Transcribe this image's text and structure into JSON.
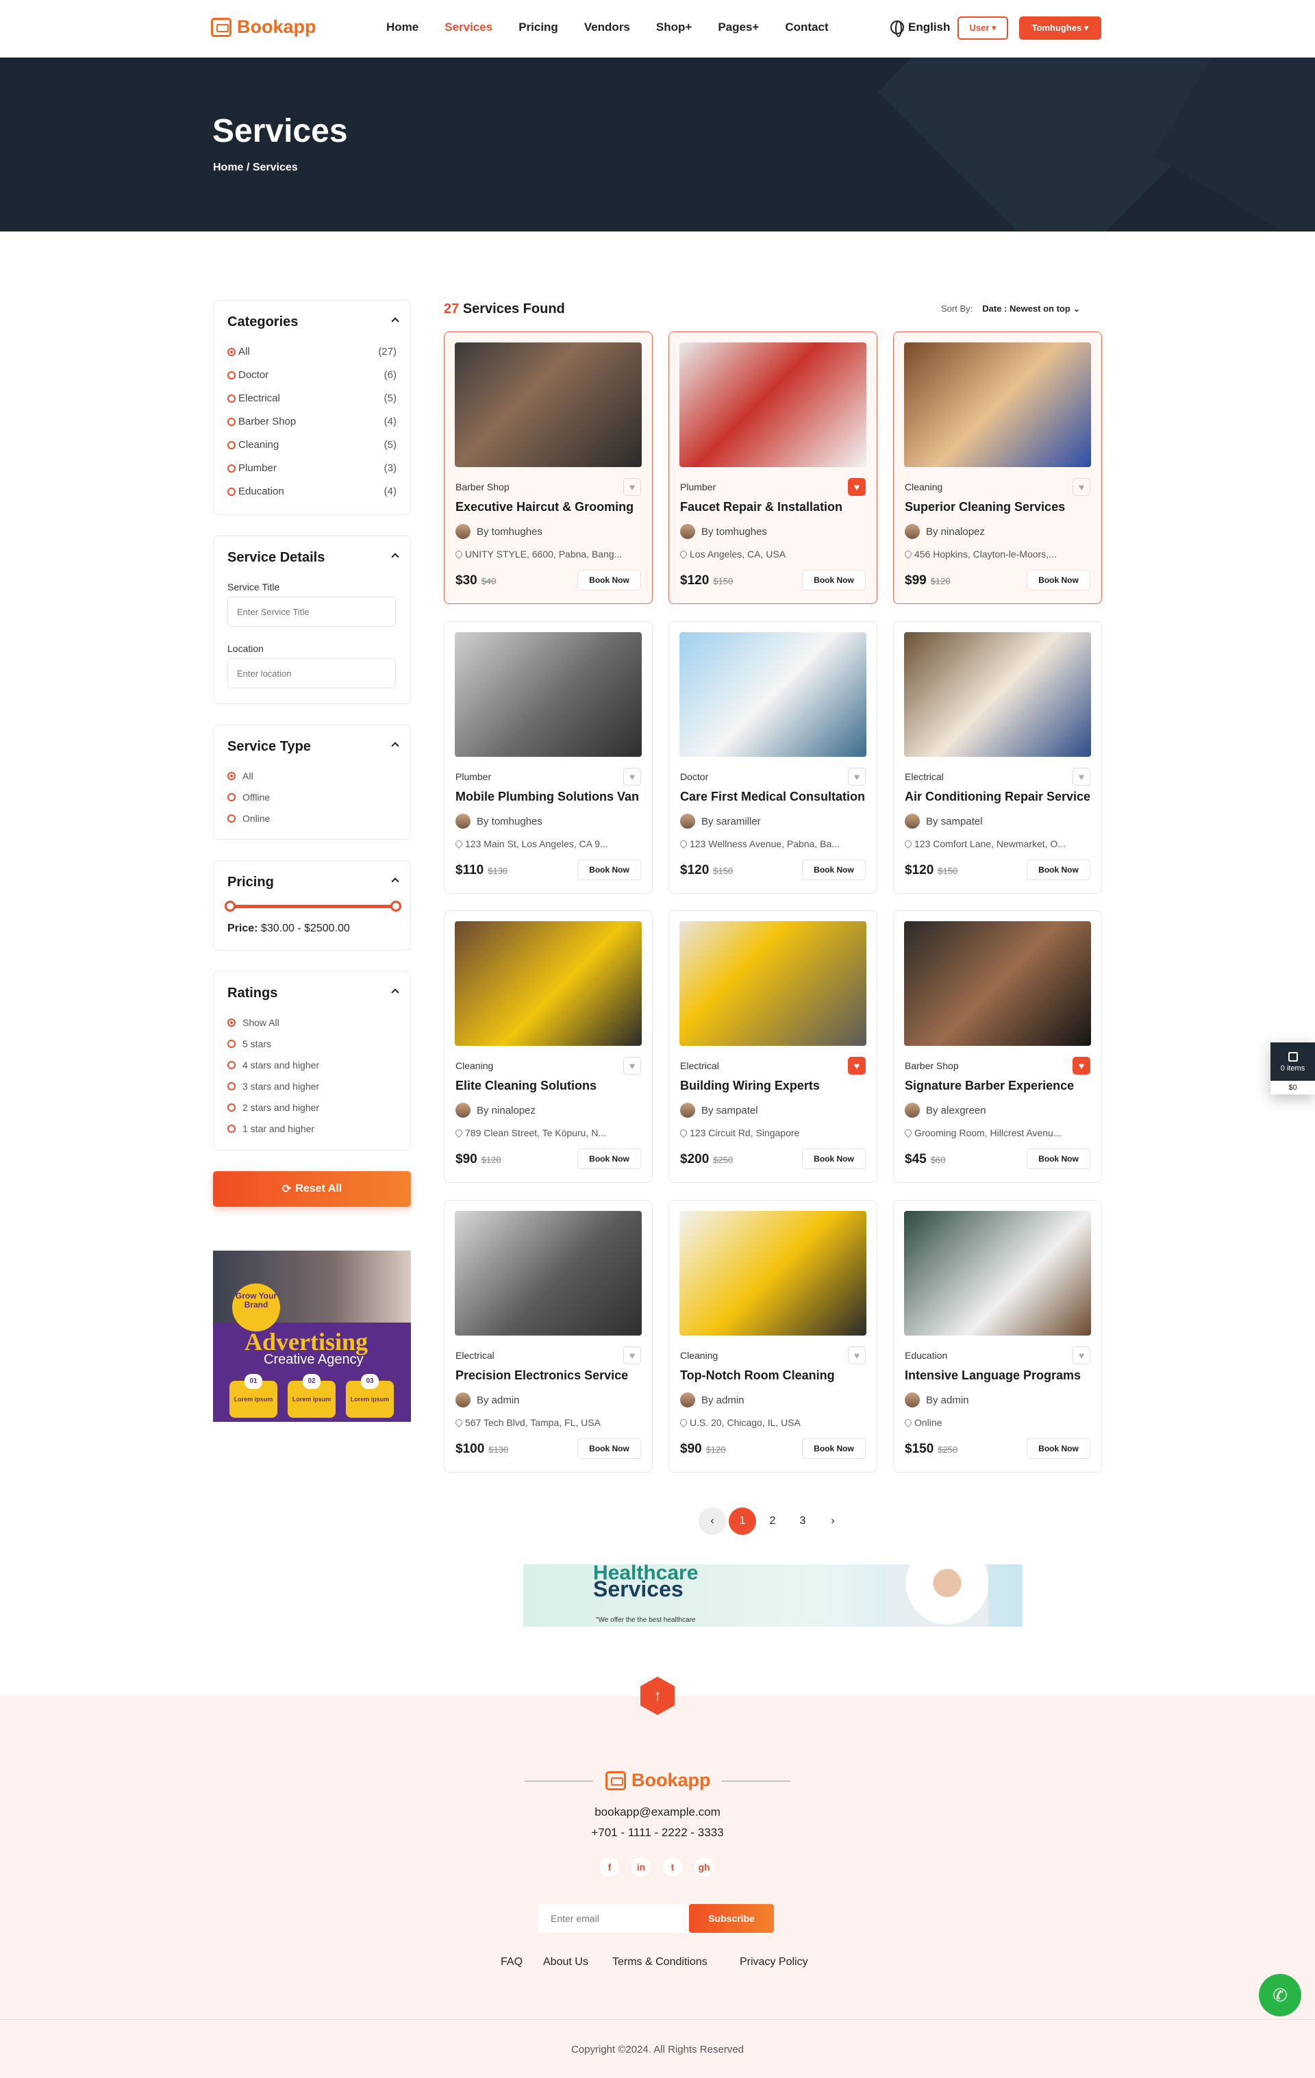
{
  "header": {
    "logo": "Bookapp",
    "nav": [
      "Home",
      "Services",
      "Pricing",
      "Vendors",
      "Shop+",
      "Pages+",
      "Contact"
    ],
    "active_nav": 1,
    "language": "English",
    "user_btn": "User ▾",
    "profile_btn": "Tomhughes ▾"
  },
  "banner": {
    "title": "Services",
    "crumb_home": "Home",
    "crumb_sep": "/",
    "crumb_current": "Services"
  },
  "sidebar": {
    "categories_title": "Categories",
    "categories": [
      {
        "name": "All",
        "count": "(27)"
      },
      {
        "name": "Doctor",
        "count": "(6)"
      },
      {
        "name": "Electrical",
        "count": "(5)"
      },
      {
        "name": "Barber Shop",
        "count": "(4)"
      },
      {
        "name": "Cleaning",
        "count": "(5)"
      },
      {
        "name": "Plumber",
        "count": "(3)"
      },
      {
        "name": "Education",
        "count": "(4)"
      }
    ],
    "details_title": "Service Details",
    "service_title_label": "Service Title",
    "service_title_placeholder": "Enter Service Title",
    "location_label": "Location",
    "location_placeholder": "Enter location",
    "type_title": "Service Type",
    "types": [
      "All",
      "Offline",
      "Online"
    ],
    "pricing_title": "Pricing",
    "price_label": "Price:",
    "price_range": "$30.00 - $2500.00",
    "ratings_title": "Ratings",
    "ratings": [
      "Show All",
      "5 stars",
      "4 stars and higher",
      "3 stars and higher",
      "2 stars and higher",
      "1 star and higher"
    ],
    "reset": "Reset All",
    "ad": {
      "grow": "Grow Your Brand",
      "title": "Advertising",
      "subtitle": "Creative Agency",
      "b1": "01",
      "b2": "02",
      "b3": "03",
      "lorem": "Lorem ipsum"
    }
  },
  "results": {
    "count": "27",
    "found_label": "Services Found",
    "sort_label": "Sort By:",
    "sort_value": "Date : Newest on top ⌄"
  },
  "services": [
    {
      "category": "Barber Shop",
      "title": "Executive Haircut & Grooming",
      "by": "By tomhughes",
      "loc": "UNITY STYLE, 6600, Pabna, Bang...",
      "price": "$30",
      "old": "$40",
      "fav": false,
      "feat": true
    },
    {
      "category": "Plumber",
      "title": "Faucet Repair & Installation",
      "by": "By tomhughes",
      "loc": "Los Angeles, CA, USA",
      "price": "$120",
      "old": "$150",
      "fav": true,
      "feat": true
    },
    {
      "category": "Cleaning",
      "title": "Superior Cleaning Services",
      "by": "By ninalopez",
      "loc": "456 Hopkins, Clayton-le-Moors,...",
      "price": "$99",
      "old": "$120",
      "fav": false,
      "feat": true
    },
    {
      "category": "Plumber",
      "title": "Mobile Plumbing Solutions Van",
      "by": "By tomhughes",
      "loc": "123 Main St, Los Angeles, CA 9...",
      "price": "$110",
      "old": "$130",
      "fav": false,
      "feat": false
    },
    {
      "category": "Doctor",
      "title": "Care First Medical Consultation",
      "by": "By saramiller",
      "loc": "123 Wellness Avenue, Pabna, Ba...",
      "price": "$120",
      "old": "$150",
      "fav": false,
      "feat": false
    },
    {
      "category": "Electrical",
      "title": "Air Conditioning Repair Service",
      "by": "By sampatel",
      "loc": "123 Comfort Lane, Newmarket, O...",
      "price": "$120",
      "old": "$150",
      "fav": false,
      "feat": false
    },
    {
      "category": "Cleaning",
      "title": "Elite Cleaning Solutions",
      "by": "By ninalopez",
      "loc": "789 Clean Street, Te Köpuru, N...",
      "price": "$90",
      "old": "$120",
      "fav": false,
      "feat": false
    },
    {
      "category": "Electrical",
      "title": "Building Wiring Experts",
      "by": "By sampatel",
      "loc": "123 Circuit Rd, Singapore",
      "price": "$200",
      "old": "$250",
      "fav": true,
      "feat": false
    },
    {
      "category": "Barber Shop",
      "title": "Signature Barber Experience",
      "by": "By alexgreen",
      "loc": "Grooming Room, Hillcrest Avenu...",
      "price": "$45",
      "old": "$60",
      "fav": true,
      "feat": false
    },
    {
      "category": "Electrical",
      "title": "Precision Electronics Service",
      "by": "By admin",
      "loc": "567 Tech Blvd, Tampa, FL, USA",
      "price": "$100",
      "old": "$130",
      "fav": false,
      "feat": false
    },
    {
      "category": "Cleaning",
      "title": "Top-Notch Room Cleaning",
      "by": "By admin",
      "loc": "U.S. 20, Chicago, IL, USA",
      "price": "$90",
      "old": "$120",
      "fav": false,
      "feat": false
    },
    {
      "category": "Education",
      "title": "Intensive Language Programs",
      "by": "By admin",
      "loc": "Online",
      "price": "$150",
      "old": "$250",
      "fav": false,
      "feat": false
    }
  ],
  "book_label": "Book Now",
  "pagination": {
    "prev": "‹",
    "pages": [
      "1",
      "2",
      "3"
    ],
    "next": "›",
    "current": 1
  },
  "hc_banner": {
    "t1": "Healthcare",
    "t2": "Services",
    "t3": "\"We offer the the best healthcare"
  },
  "footer": {
    "logo": "Bookapp",
    "email": "bookapp@example.com",
    "phone": "+701 - 1111 - 2222 - 3333",
    "social": [
      "f",
      "in",
      "t",
      "gh"
    ],
    "email_placeholder": "Enter email",
    "subscribe": "Subscribe",
    "links": [
      "FAQ",
      "About Us",
      "Terms & Conditions",
      "Privacy Policy"
    ],
    "copyright": "Copyright ©2024. All Rights Reserved"
  },
  "cart": {
    "items": "0 items",
    "total": "$0"
  },
  "colors": {
    "accent": "#ee4d2d",
    "brand": "#f26a1b",
    "dark": "#1c2733"
  }
}
